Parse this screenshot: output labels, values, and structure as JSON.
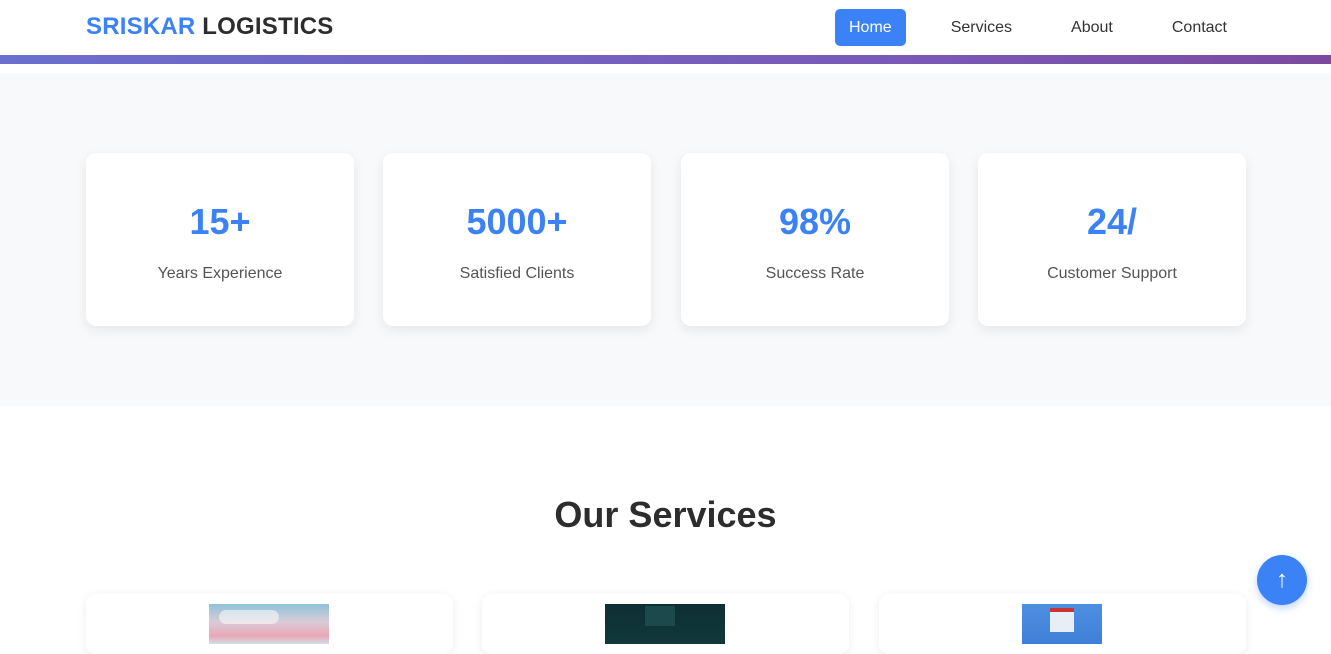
{
  "header": {
    "logo_brand": "SRISKAR",
    "logo_rest": "LOGISTICS",
    "nav": [
      {
        "label": "Home",
        "active": true
      },
      {
        "label": "Services",
        "active": false
      },
      {
        "label": "About",
        "active": false
      },
      {
        "label": "Contact",
        "active": false
      }
    ]
  },
  "stats": [
    {
      "value": "15+",
      "label": "Years Experience"
    },
    {
      "value": "5000+",
      "label": "Satisfied Clients"
    },
    {
      "value": "98%",
      "label": "Success Rate"
    },
    {
      "value": "24/",
      "label": "Customer Support"
    }
  ],
  "services": {
    "title": "Our Services"
  },
  "back_to_top": {
    "icon": "up-arrow-icon",
    "glyph": "↑"
  },
  "colors": {
    "accent": "#3b82f6",
    "header_rule": "#6f5fbf",
    "stats_bg": "#f8f9fb"
  }
}
